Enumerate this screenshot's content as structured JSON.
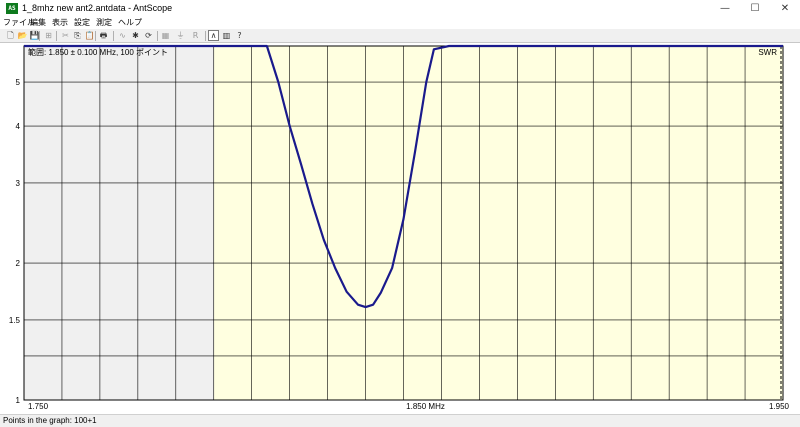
{
  "window": {
    "title": "1_8mhz new ant2.antdata - AntScope",
    "app_icon_text": "AS",
    "minimize": "—",
    "maximize": "☐",
    "close": "✕"
  },
  "menu": [
    {
      "label": "ファイル"
    },
    {
      "label": "編集"
    },
    {
      "label": "表示"
    },
    {
      "label": "設定"
    },
    {
      "label": "測定"
    },
    {
      "label": "ヘルプ"
    }
  ],
  "toolbar": [
    {
      "name": "new-icon",
      "glyph": "🗋",
      "enabled": true
    },
    {
      "name": "open-icon",
      "glyph": "📂",
      "enabled": true
    },
    {
      "name": "save-icon",
      "glyph": "💾",
      "enabled": true
    },
    {
      "name": "add-icon",
      "glyph": "⊞",
      "enabled": false
    },
    {
      "name": "cut-icon",
      "glyph": "✂",
      "enabled": false
    },
    {
      "name": "copy-icon",
      "glyph": "⎘",
      "enabled": true
    },
    {
      "name": "paste-icon",
      "glyph": "📋",
      "enabled": true
    },
    {
      "name": "print-icon",
      "glyph": "🖶",
      "enabled": true
    },
    {
      "name": "graph-icon",
      "glyph": "∿",
      "enabled": false
    },
    {
      "name": "marker-icon",
      "glyph": "✱",
      "enabled": true
    },
    {
      "name": "refresh-icon",
      "glyph": "⟳",
      "enabled": true
    },
    {
      "name": "scale-icon",
      "glyph": "▦",
      "enabled": false
    },
    {
      "name": "filter-icon",
      "glyph": "⏚",
      "enabled": false
    },
    {
      "name": "rq-icon",
      "glyph": "R",
      "enabled": false
    },
    {
      "name": "swr-icon",
      "glyph": "∧",
      "enabled": true,
      "active": true
    },
    {
      "name": "chart-icon",
      "glyph": "▥",
      "enabled": true
    },
    {
      "name": "help-icon",
      "glyph": "?",
      "enabled": true
    }
  ],
  "status": {
    "text": "Points in the graph: 100+1"
  },
  "chart_data": {
    "type": "line",
    "annotation": "範囲: 1.850 ± 0.100 MHz, 100 ポイント",
    "series_label": "SWR",
    "xlim": [
      1.75,
      1.95
    ],
    "x_ticks": [
      {
        "value": 1.75,
        "label": "1.750"
      },
      {
        "value": 1.85,
        "label": "1.850 MHz"
      },
      {
        "value": 1.95,
        "label": "1.950"
      }
    ],
    "x_grid_step": 0.01,
    "y_scale": "log",
    "ylim": [
      1,
      6
    ],
    "y_ticks": [
      {
        "value": 1,
        "label": "1"
      },
      {
        "value": 1.5,
        "label": "1.5"
      },
      {
        "value": 2,
        "label": "2"
      },
      {
        "value": 3,
        "label": "3"
      },
      {
        "value": 4,
        "label": "4"
      },
      {
        "value": 5,
        "label": "5"
      }
    ],
    "y_grid": [
      1.25,
      1.5,
      2,
      3,
      4,
      5
    ],
    "shaded_band": {
      "from": 1.75,
      "to": 1.8,
      "color": "#f0f0f0"
    },
    "plot_background": "#ffffe0",
    "line_color": "#1a1a8c",
    "series": [
      {
        "x": [
          1.75,
          1.8,
          1.814,
          1.817,
          1.82,
          1.823,
          1.826,
          1.829,
          1.832,
          1.835,
          1.838,
          1.84,
          1.842,
          1.844,
          1.847,
          1.85,
          1.853,
          1.856,
          1.858,
          1.862,
          1.95
        ],
        "y": [
          6,
          6,
          6,
          5.0,
          4.0,
          3.3,
          2.7,
          2.25,
          1.95,
          1.73,
          1.62,
          1.6,
          1.62,
          1.72,
          1.95,
          2.5,
          3.5,
          5.0,
          5.9,
          6,
          6
        ]
      }
    ]
  }
}
